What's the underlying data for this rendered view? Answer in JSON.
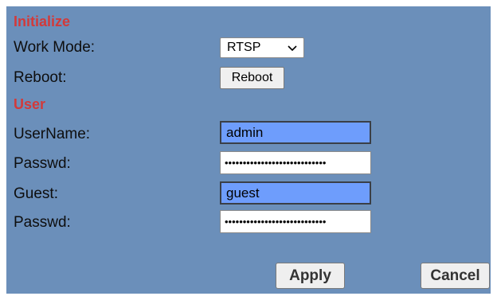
{
  "sections": {
    "initialize_title": "Initialize",
    "user_title": "User"
  },
  "initialize": {
    "work_mode_label": "Work Mode:",
    "work_mode_value": "RTSP",
    "reboot_label": "Reboot:",
    "reboot_button": "Reboot"
  },
  "user": {
    "username_label": "UserName:",
    "username_value": "admin",
    "passwd1_label": "Passwd:",
    "passwd1_value": "••••••••••••••••••••••••••••",
    "guest_label": "Guest:",
    "guest_value": "guest",
    "passwd2_label": "Passwd:",
    "passwd2_value": "••••••••••••••••••••••••••••"
  },
  "actions": {
    "apply": "Apply",
    "cancel": "Cancel"
  },
  "colors": {
    "panel_bg": "#6b8fba",
    "section_title": "#d23a3a",
    "highlight_field": "#6e9dfc"
  },
  "icons": {
    "dropdown": "chevron-down-icon"
  }
}
